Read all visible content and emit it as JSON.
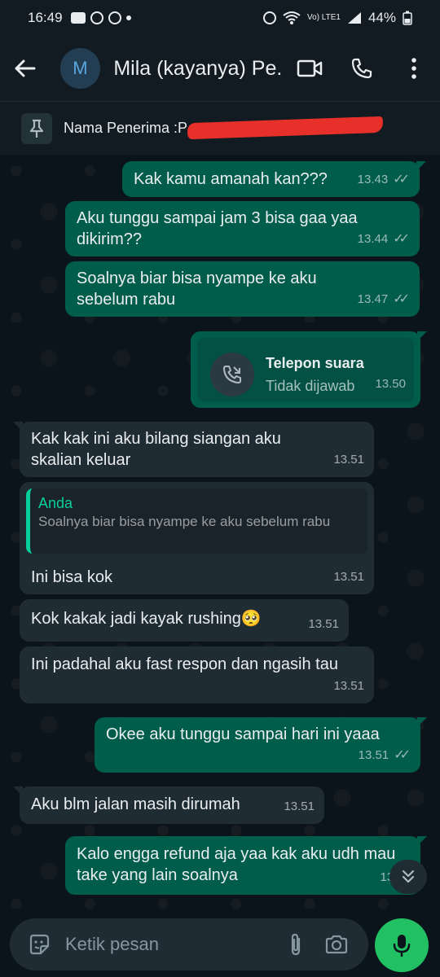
{
  "status": {
    "time": "16:49",
    "battery": "44%",
    "volte_label": "Vo) LTE1"
  },
  "header": {
    "avatar_letter": "M",
    "title": "Mila (kayanya) Pe..."
  },
  "pinned": {
    "text": "Nama Penerima :P"
  },
  "messages": [
    {
      "text": "Kak kamu amanah kan???",
      "time": "13.43"
    },
    {
      "text": "Aku tunggu sampai jam 3 bisa gaa yaa dikirim??",
      "time": "13.44"
    },
    {
      "text": "Soalnya biar bisa nyampe ke aku sebelum rabu",
      "time": "13.47"
    },
    {
      "call_title": "Telepon suara",
      "call_status": "Tidak dijawab",
      "time": "13.50"
    },
    {
      "text": "Kak kak ini aku bilang siangan aku skalian keluar",
      "time": "13.51"
    },
    {
      "quote_name": "Anda",
      "quote_text": "Soalnya biar bisa nyampe ke aku sebelum rabu",
      "text": "Ini bisa kok",
      "time": "13.51"
    },
    {
      "text": "Kok kakak jadi kayak rushing🥺",
      "time": "13.51"
    },
    {
      "text": "Ini padahal aku fast respon dan ngasih tau",
      "time": "13.51"
    },
    {
      "text": "Okee aku tunggu sampai hari ini yaaa",
      "time": "13.51"
    },
    {
      "text": "Aku blm jalan masih dirumah",
      "time": "13.51"
    },
    {
      "text": "Kalo engga refund aja yaa kak aku udh mau take yang lain soalnya",
      "time": "13.51"
    }
  ],
  "input": {
    "placeholder": "Ketik pesan"
  },
  "colors": {
    "outgoing": "#005c4b",
    "incoming": "#202c33",
    "accent": "#21c063",
    "background": "#0b141a"
  }
}
